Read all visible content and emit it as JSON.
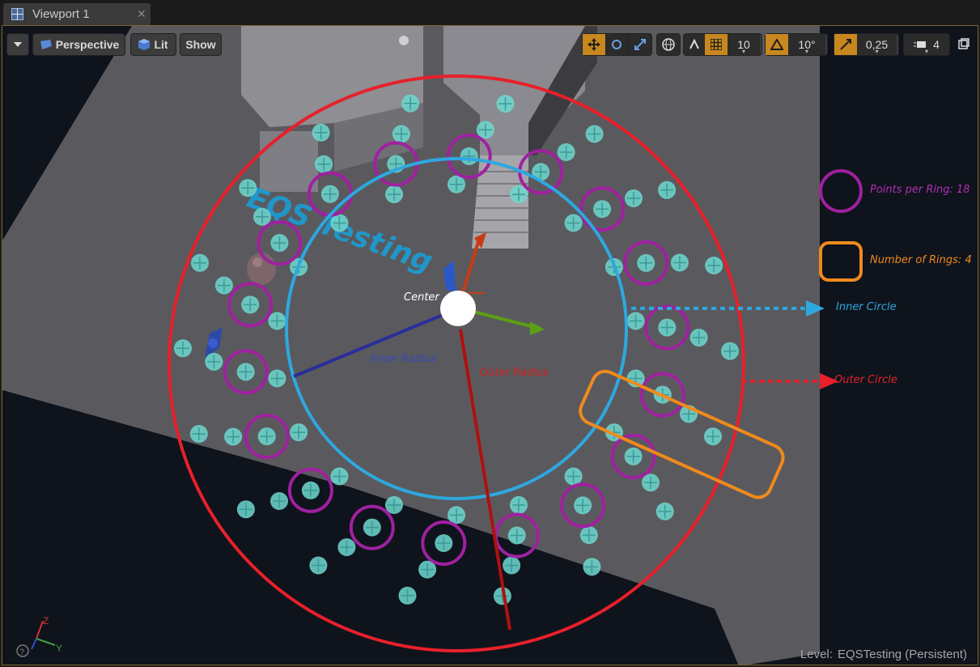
{
  "window": {
    "tab_title": "Viewport 1",
    "tab_close": "✕"
  },
  "toolbar": {
    "perspective_label": "Perspective",
    "lit_label": "Lit",
    "show_label": "Show",
    "grid_snap_value": "10",
    "rotation_snap_value": "10°",
    "scale_snap_value": "0,25",
    "camera_speed_value": "4"
  },
  "scene": {
    "floor_text": "EQS Testing",
    "center_label": "Center",
    "inner_radius_label": "Inner Radius",
    "outer_radius_label": "Outer Radius",
    "axes": {
      "x": "X",
      "y": "Y",
      "z": "Z"
    }
  },
  "legend": {
    "points_per_ring": "Points per Ring: 18",
    "number_of_rings": "Number of Rings: 4",
    "inner_circle": "Inner Circle",
    "outer_circle": "Outer Circle"
  },
  "status": {
    "level_prefix": "Level:",
    "level_name": "EQSTesting (Persistent)"
  },
  "colors": {
    "inner_circle": "#2ea8e0",
    "outer_circle": "#e8202a",
    "ring_marker": "#a020a0",
    "rings_box": "#f08a1c",
    "inner_radius_line": "#2a2e9a",
    "outer_radius_line": "#b01010",
    "query_point": "#6ed8d0",
    "toolbar_active": "#c8871f"
  }
}
